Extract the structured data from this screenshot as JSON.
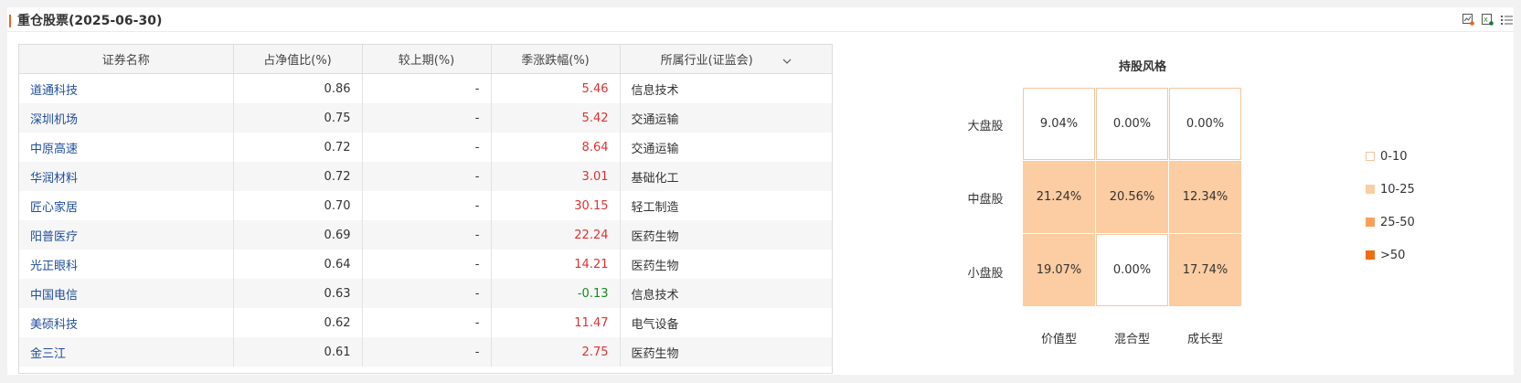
{
  "header": {
    "title": "重仓股票(2025-06-30)"
  },
  "table": {
    "columns": [
      "证券名称",
      "占净值比(%)",
      "较上期(%)",
      "季涨跌幅(%)",
      "所属行业(证监会)"
    ],
    "rows": [
      {
        "name": "道通科技",
        "ratio": "0.86",
        "change": "-",
        "quarter": "5.46",
        "industry": "信息技术"
      },
      {
        "name": "深圳机场",
        "ratio": "0.75",
        "change": "-",
        "quarter": "5.42",
        "industry": "交通运输"
      },
      {
        "name": "中原高速",
        "ratio": "0.72",
        "change": "-",
        "quarter": "8.64",
        "industry": "交通运输"
      },
      {
        "name": "华润材料",
        "ratio": "0.72",
        "change": "-",
        "quarter": "3.01",
        "industry": "基础化工"
      },
      {
        "name": "匠心家居",
        "ratio": "0.70",
        "change": "-",
        "quarter": "30.15",
        "industry": "轻工制造"
      },
      {
        "name": "阳普医疗",
        "ratio": "0.69",
        "change": "-",
        "quarter": "22.24",
        "industry": "医药生物"
      },
      {
        "name": "光正眼科",
        "ratio": "0.64",
        "change": "-",
        "quarter": "14.21",
        "industry": "医药生物"
      },
      {
        "name": "中国电信",
        "ratio": "0.63",
        "change": "-",
        "quarter": "-0.13",
        "industry": "信息技术"
      },
      {
        "name": "美硕科技",
        "ratio": "0.62",
        "change": "-",
        "quarter": "11.47",
        "industry": "电气设备"
      },
      {
        "name": "金三江",
        "ratio": "0.61",
        "change": "-",
        "quarter": "2.75",
        "industry": "医药生物"
      }
    ],
    "colors": {
      "up": "#e03131",
      "down": "#14891d",
      "link": "#1f4e9c"
    }
  },
  "style_box": {
    "title": "持股风格",
    "rows": [
      "大盘股",
      "中盘股",
      "小盘股"
    ],
    "cols": [
      "价值型",
      "混合型",
      "成长型"
    ],
    "cells": [
      [
        "9.04%",
        "0.00%",
        "0.00%"
      ],
      [
        "21.24%",
        "20.56%",
        "12.34%"
      ],
      [
        "19.07%",
        "0.00%",
        "17.74%"
      ]
    ],
    "values": [
      [
        9.04,
        0.0,
        0.0
      ],
      [
        21.24,
        20.56,
        12.34
      ],
      [
        19.07,
        0.0,
        17.74
      ]
    ],
    "legend": [
      {
        "label": "0-10",
        "color": "#ffffff"
      },
      {
        "label": "10-25",
        "color": "#fccca2"
      },
      {
        "label": "25-50",
        "color": "#f9a15c"
      },
      {
        "label": ">50",
        "color": "#f26b11"
      }
    ]
  }
}
